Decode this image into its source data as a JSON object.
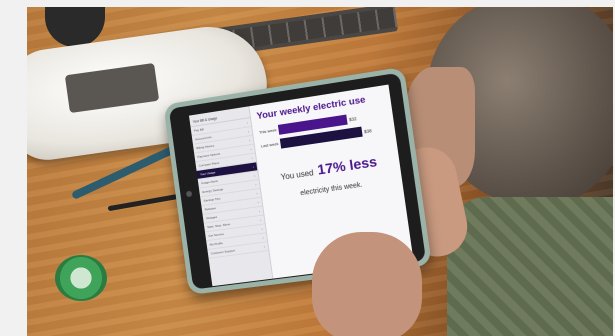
{
  "app": {
    "nav_title": "Your Bill & Usage",
    "nav_items": [
      {
        "label": "Pay Bill",
        "chevron": "›"
      },
      {
        "label": "Account Info",
        "chevron": "›"
      },
      {
        "label": "Billing History",
        "chevron": "›"
      },
      {
        "label": "Payment Options",
        "chevron": "›"
      },
      {
        "label": "Compare Plans",
        "chevron": "›"
      },
      {
        "label": "Your Usage",
        "chevron": "›",
        "active": true
      },
      {
        "label": "Usage Alerts",
        "chevron": "›"
      },
      {
        "label": "Energy Savings",
        "chevron": "›"
      },
      {
        "label": "Savings Tips",
        "chevron": "›"
      },
      {
        "label": "Rebates",
        "chevron": "›"
      },
      {
        "label": "Outages",
        "chevron": "›"
      },
      {
        "label": "Start, Stop, Move",
        "chevron": "›"
      },
      {
        "label": "Get Service",
        "chevron": "›"
      },
      {
        "label": "My Profile",
        "chevron": "›"
      },
      {
        "label": "Customer Support",
        "chevron": "›"
      }
    ],
    "heading": "Your weekly electric use",
    "usage_rows": [
      {
        "label": "This week",
        "value_label": "$32",
        "value": 32,
        "color": "#4a148c"
      },
      {
        "label": "Last week",
        "value_label": "$38",
        "value": 38,
        "color": "#1c1140"
      }
    ],
    "summary_prefix": "You used",
    "summary_percent": "17% less",
    "summary_suffix": "electricity this week."
  },
  "colors": {
    "accent": "#4a148c",
    "active_nav": "#1c1140"
  }
}
